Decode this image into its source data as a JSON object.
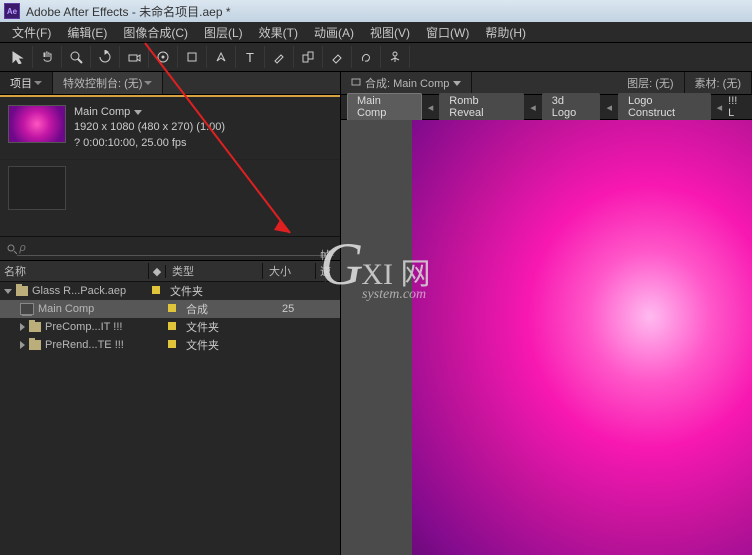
{
  "title": "Adobe After Effects - 未命名项目.aep *",
  "logo_text": "Ae",
  "menu": [
    "文件(F)",
    "编辑(E)",
    "图像合成(C)",
    "图层(L)",
    "效果(T)",
    "动画(A)",
    "视图(V)",
    "窗口(W)",
    "帮助(H)"
  ],
  "left_tabs": {
    "project": "项目",
    "effects": "特效控制台: (无)"
  },
  "comp_info": {
    "name": "Main Comp",
    "dims": "1920 x 1080  (480 x 270) (1.00)",
    "dur": "? 0:00:10:00, 25.00 fps"
  },
  "search_placeholder": "ρ",
  "columns": {
    "name": "名称",
    "tag": "◆",
    "type": "类型",
    "size": "大小",
    "rate": "帧速率"
  },
  "rows": [
    {
      "name": "Glass R...Pack.aep",
      "type": "文件夹",
      "kind": "folder",
      "open": true,
      "tag": true,
      "indent": 0,
      "sel": false
    },
    {
      "name": "Main Comp",
      "type": "合成",
      "kind": "comp",
      "tag": true,
      "size": "25",
      "indent": 1,
      "sel": true
    },
    {
      "name": "PreComp...IT !!!",
      "type": "文件夹",
      "kind": "folder",
      "open": false,
      "tag": true,
      "indent": 1,
      "sel": false
    },
    {
      "name": "PreRend...TE !!!",
      "type": "文件夹",
      "kind": "folder",
      "open": false,
      "tag": true,
      "indent": 1,
      "sel": false
    }
  ],
  "right_top": {
    "comp_label": "合成: Main Comp",
    "layer_label": "图层: (无)",
    "footage_label": "素材: (无)"
  },
  "breadcrumbs": [
    "Main Comp",
    "Romb Reveal",
    "3d Logo",
    "Logo Construct"
  ],
  "breadcrumb_tail": "!!! L",
  "watermark": {
    "brand_g": "G",
    "brand_big": "XI 网",
    "brand_sub": "system.com"
  }
}
